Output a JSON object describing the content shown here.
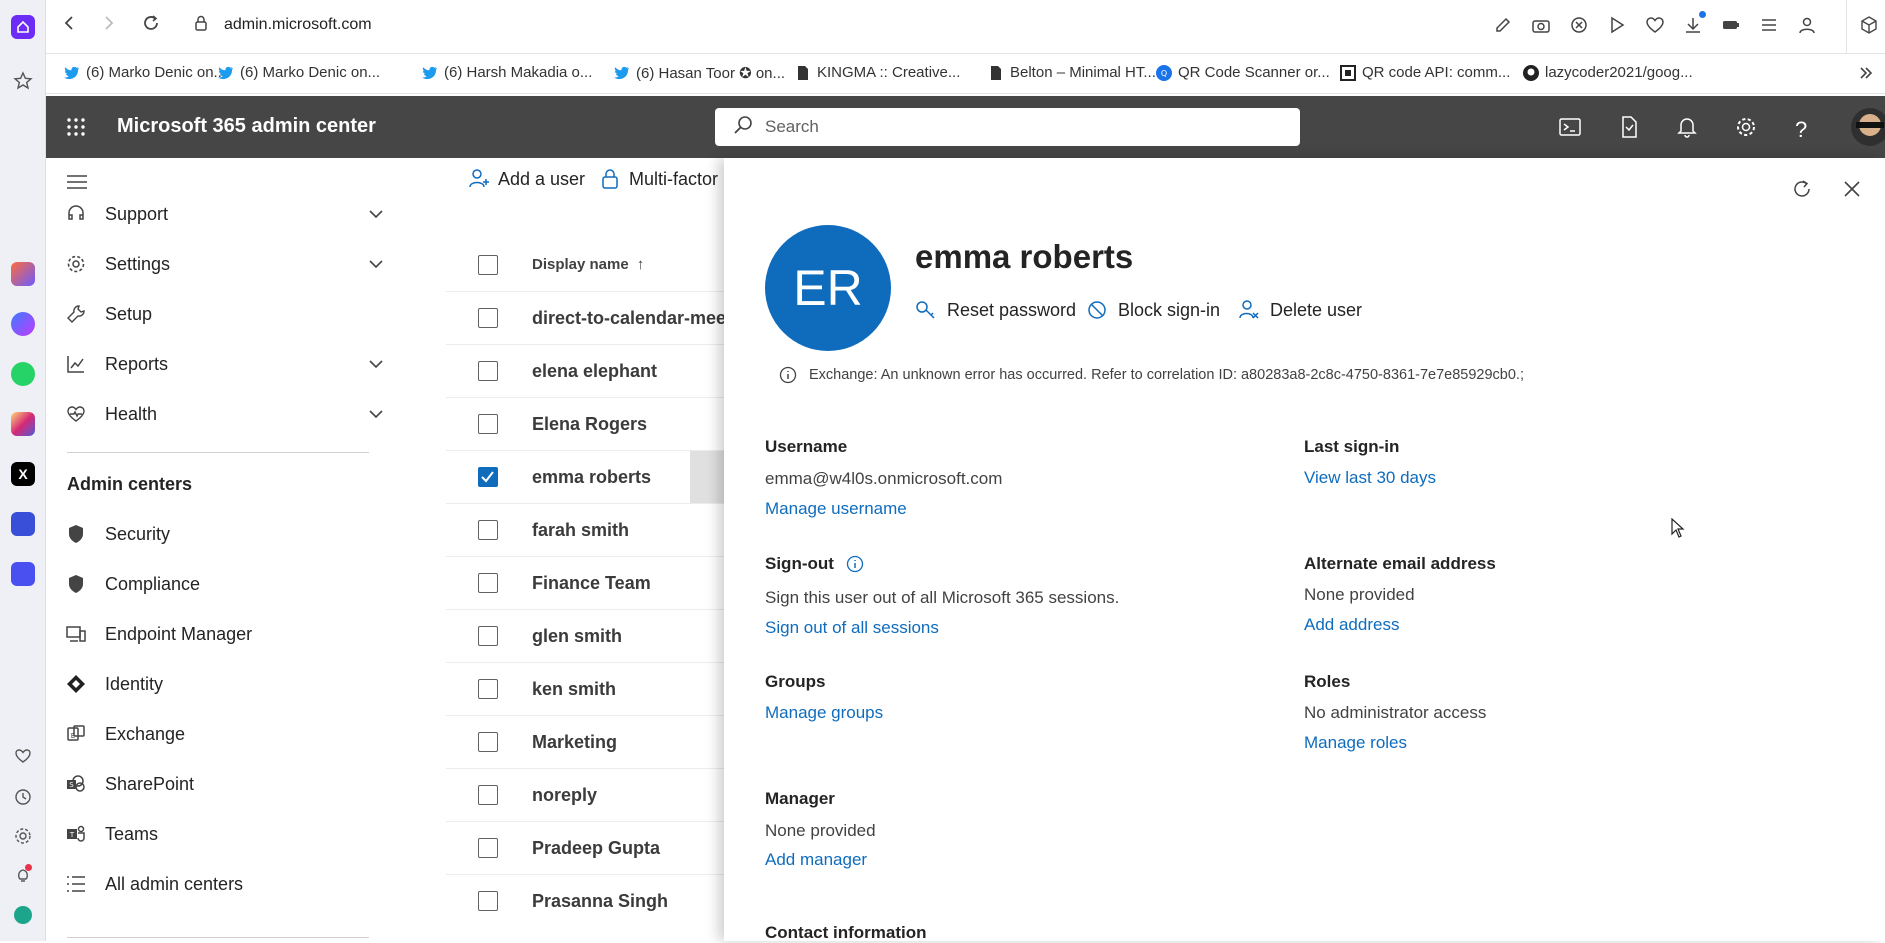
{
  "browser": {
    "url": "admin.microsoft.com",
    "bookmarks": [
      {
        "label": "(6) Marko Denic on...",
        "icon": "twitter-icon"
      },
      {
        "label": "(6) Marko Denic on...",
        "icon": "twitter-icon"
      },
      {
        "label": "(6) Harsh Makadia o...",
        "icon": "twitter-icon"
      },
      {
        "label": "(6) Hasan Toor ✪ on...",
        "icon": "twitter-icon"
      },
      {
        "label": "KINGMA :: Creative...",
        "icon": "page-icon"
      },
      {
        "label": "Belton – Minimal HT...",
        "icon": "page-icon"
      },
      {
        "label": "QR Code Scanner or...",
        "icon": "qr-site-icon"
      },
      {
        "label": "QR code API: comm...",
        "icon": "qr-api-icon"
      },
      {
        "label": "lazycoder2021/goog...",
        "icon": "github-icon"
      }
    ]
  },
  "header": {
    "app_title": "Microsoft 365 admin center",
    "search_placeholder": "Search"
  },
  "nav": {
    "items": [
      {
        "label": "Support",
        "icon": "headset-icon",
        "expand": true
      },
      {
        "label": "Settings",
        "icon": "gear-icon",
        "expand": true
      },
      {
        "label": "Setup",
        "icon": "wrench-icon",
        "expand": false
      },
      {
        "label": "Reports",
        "icon": "chart-icon",
        "expand": true
      },
      {
        "label": "Health",
        "icon": "heart-icon",
        "expand": true
      }
    ],
    "admin_centers_heading": "Admin centers",
    "admin_centers": [
      {
        "label": "Security",
        "icon": "shield-icon"
      },
      {
        "label": "Compliance",
        "icon": "shield-icon"
      },
      {
        "label": "Endpoint Manager",
        "icon": "device-icon"
      },
      {
        "label": "Identity",
        "icon": "identity-icon"
      },
      {
        "label": "Exchange",
        "icon": "exchange-icon"
      },
      {
        "label": "SharePoint",
        "icon": "sharepoint-icon"
      },
      {
        "label": "Teams",
        "icon": "teams-icon"
      },
      {
        "label": "All admin centers",
        "icon": "list-icon"
      }
    ]
  },
  "toolbar": {
    "add_user": "Add a user",
    "mfa": "Multi-factor"
  },
  "users": {
    "column_header": "Display name",
    "sort_indicator": "↑",
    "rows": [
      {
        "name": "direct-to-calendar-meeti",
        "checked": false
      },
      {
        "name": "elena elephant",
        "checked": false
      },
      {
        "name": "Elena Rogers",
        "checked": false
      },
      {
        "name": "emma roberts",
        "checked": true
      },
      {
        "name": "farah smith",
        "checked": false
      },
      {
        "name": "Finance Team",
        "checked": false
      },
      {
        "name": "glen smith",
        "checked": false
      },
      {
        "name": "ken smith",
        "checked": false
      },
      {
        "name": "Marketing",
        "checked": false
      },
      {
        "name": "noreply",
        "checked": false
      },
      {
        "name": "Pradeep Gupta",
        "checked": false
      },
      {
        "name": "Prasanna Singh",
        "checked": false
      }
    ]
  },
  "panel": {
    "initials": "ER",
    "display_name": "emma roberts",
    "actions": {
      "reset_password": "Reset password",
      "block_signin": "Block sign-in",
      "delete_user": "Delete user"
    },
    "error_message": "Exchange: An unknown error has occurred. Refer to correlation ID: a80283a8-2c8c-4750-8361-7e7e85929cb0.;",
    "username_label": "Username",
    "username_value": "emma@w4l0s.onmicrosoft.com",
    "manage_username": "Manage username",
    "last_signin_label": "Last sign-in",
    "view_last_30": "View last 30 days",
    "signout_label": "Sign-out",
    "signout_desc": "Sign this user out of all Microsoft 365 sessions.",
    "signout_link": "Sign out of all sessions",
    "alt_email_label": "Alternate email address",
    "alt_email_value": "None provided",
    "add_address": "Add address",
    "groups_label": "Groups",
    "manage_groups": "Manage groups",
    "roles_label": "Roles",
    "roles_value": "No administrator access",
    "manage_roles": "Manage roles",
    "manager_label": "Manager",
    "manager_value": "None provided",
    "add_manager": "Add manager",
    "contact_label": "Contact information"
  },
  "colors": {
    "accent": "#0f6cbd",
    "header_bg": "#464646",
    "avatar_bg": "#0f6cbd"
  }
}
